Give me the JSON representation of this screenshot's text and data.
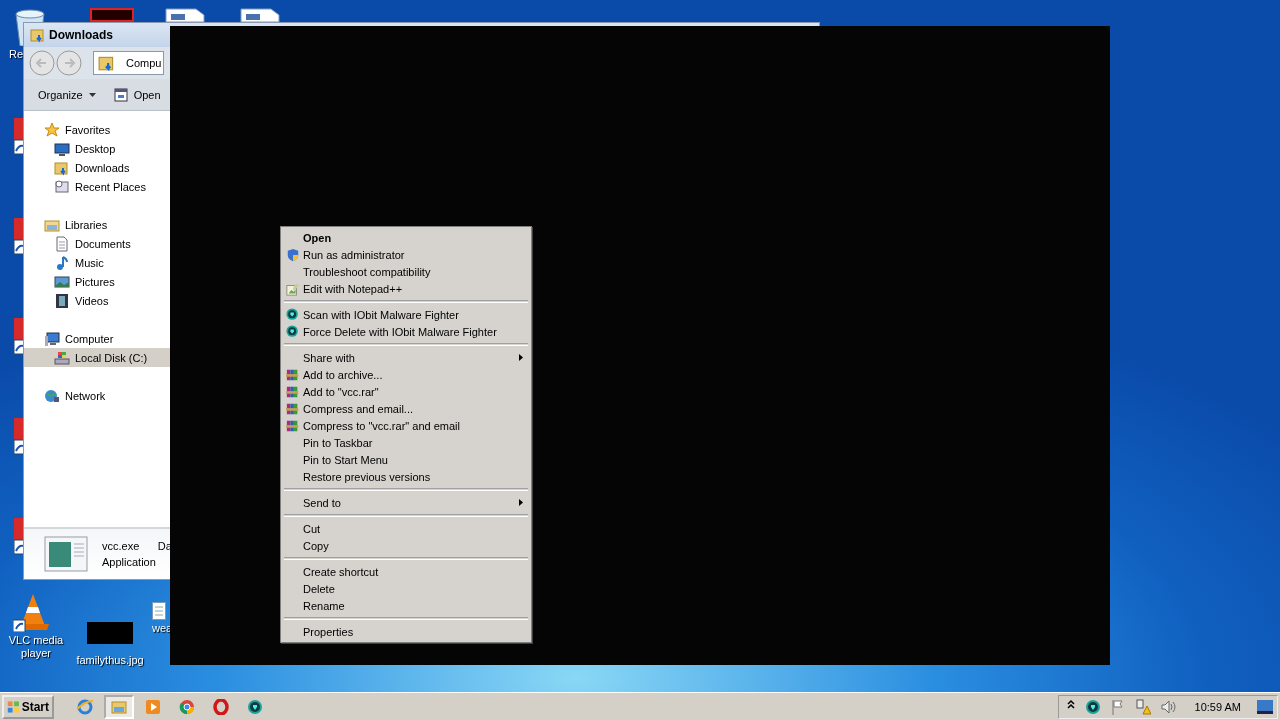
{
  "desktop": {
    "icons": [
      {
        "label": "Re",
        "kind": "recycle"
      },
      {
        "label": "VLC media player",
        "kind": "vlc"
      },
      {
        "label": "familythus.jpg",
        "kind": "hidden"
      },
      {
        "label": "wea",
        "kind": "document"
      }
    ]
  },
  "explorer": {
    "title": "Downloads",
    "address": "Compu",
    "toolbar": [
      {
        "label": "Organize",
        "kind": "menu"
      },
      {
        "label": "Open",
        "kind": "open"
      }
    ],
    "nav": [
      {
        "label": "Favorites",
        "kind": "star",
        "selected": false,
        "children": [
          {
            "label": "Desktop",
            "kind": "desktop",
            "selected": false
          },
          {
            "label": "Downloads",
            "kind": "folder",
            "selected": false
          },
          {
            "label": "Recent Places",
            "kind": "recent",
            "selected": false
          }
        ]
      },
      {
        "label": "Libraries",
        "kind": "library",
        "selected": false,
        "children": [
          {
            "label": "Documents",
            "kind": "doc",
            "selected": false
          },
          {
            "label": "Music",
            "kind": "music",
            "selected": false
          },
          {
            "label": "Pictures",
            "kind": "pictures",
            "selected": false
          },
          {
            "label": "Videos",
            "kind": "videos",
            "selected": false
          }
        ]
      },
      {
        "label": "Computer",
        "kind": "computer",
        "selected": false,
        "children": [
          {
            "label": "Local Disk (C:)",
            "kind": "disk",
            "selected": true
          }
        ]
      },
      {
        "label": "Network",
        "kind": "network",
        "selected": false
      }
    ],
    "details": {
      "name": "vcc.exe",
      "column_2": "Da",
      "type": "Application"
    }
  },
  "context_menu": {
    "groups": [
      [
        {
          "label": "Open",
          "kind": "plain",
          "bold": true,
          "submenu": false
        },
        {
          "label": "Run as administrator",
          "kind": "shield",
          "bold": false,
          "submenu": false
        },
        {
          "label": "Troubleshoot compatibility",
          "kind": "plain",
          "bold": false,
          "submenu": false
        },
        {
          "label": "Edit with Notepad++",
          "kind": "notepad",
          "bold": false,
          "submenu": false
        }
      ],
      [
        {
          "label": "Scan with IObit Malware Fighter",
          "kind": "iobit",
          "bold": false,
          "submenu": false
        },
        {
          "label": "Force Delete with IObit Malware Fighter",
          "kind": "iobit",
          "bold": false,
          "submenu": false
        }
      ],
      [
        {
          "label": "Share with",
          "kind": "plain",
          "bold": false,
          "submenu": true
        },
        {
          "label": "Add to archive...",
          "kind": "rar",
          "bold": false,
          "submenu": false
        },
        {
          "label": "Add to \"vcc.rar\"",
          "kind": "rar",
          "bold": false,
          "submenu": false
        },
        {
          "label": "Compress and email...",
          "kind": "rar",
          "bold": false,
          "submenu": false
        },
        {
          "label": "Compress to \"vcc.rar\" and email",
          "kind": "rar",
          "bold": false,
          "submenu": false
        },
        {
          "label": "Pin to Taskbar",
          "kind": "plain",
          "bold": false,
          "submenu": false
        },
        {
          "label": "Pin to Start Menu",
          "kind": "plain",
          "bold": false,
          "submenu": false
        },
        {
          "label": "Restore previous versions",
          "kind": "plain",
          "bold": false,
          "submenu": false
        }
      ],
      [
        {
          "label": "Send to",
          "kind": "plain",
          "bold": false,
          "submenu": true
        }
      ],
      [
        {
          "label": "Cut",
          "kind": "plain",
          "bold": false,
          "submenu": false
        },
        {
          "label": "Copy",
          "kind": "plain",
          "bold": false,
          "submenu": false
        }
      ],
      [
        {
          "label": "Create shortcut",
          "kind": "plain",
          "bold": false,
          "submenu": false
        },
        {
          "label": "Delete",
          "kind": "plain",
          "bold": false,
          "submenu": false
        },
        {
          "label": "Rename",
          "kind": "plain",
          "bold": false,
          "submenu": false
        }
      ],
      [
        {
          "label": "Properties",
          "kind": "plain",
          "bold": false,
          "submenu": false
        }
      ]
    ]
  },
  "taskbar": {
    "start": "Start",
    "apps": [
      {
        "kind": "ie",
        "selected": false
      },
      {
        "kind": "explorer",
        "selected": true
      },
      {
        "kind": "media",
        "selected": false
      },
      {
        "kind": "chrome",
        "selected": false
      },
      {
        "kind": "opera",
        "selected": false
      },
      {
        "kind": "iobit",
        "selected": false
      }
    ],
    "clock": "10:59 AM"
  }
}
